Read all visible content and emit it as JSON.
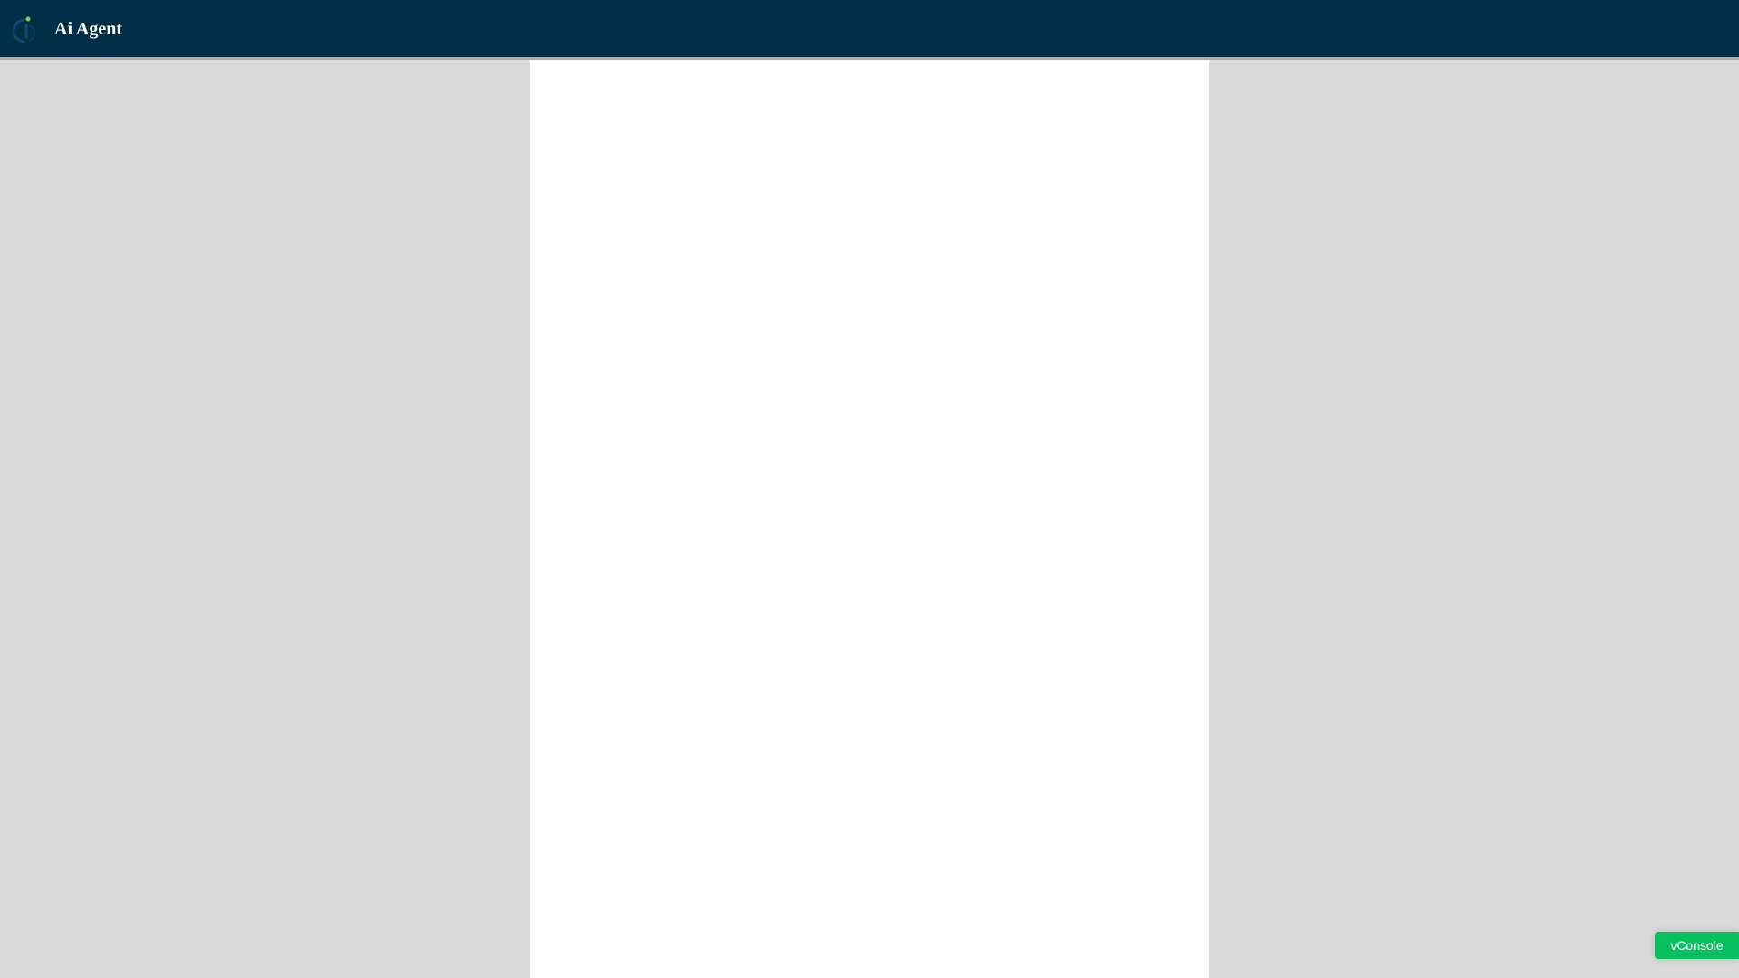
{
  "header": {
    "title": "Ai Agent",
    "logo_icon": "agent-logo-icon",
    "background_color": "#022f48",
    "logo_accent_color": "#8dc63f"
  },
  "vconsole": {
    "label": "vConsole",
    "color": "#07c160"
  },
  "page": {
    "background_color": "#d9d9d9",
    "panel_color": "#ffffff"
  }
}
